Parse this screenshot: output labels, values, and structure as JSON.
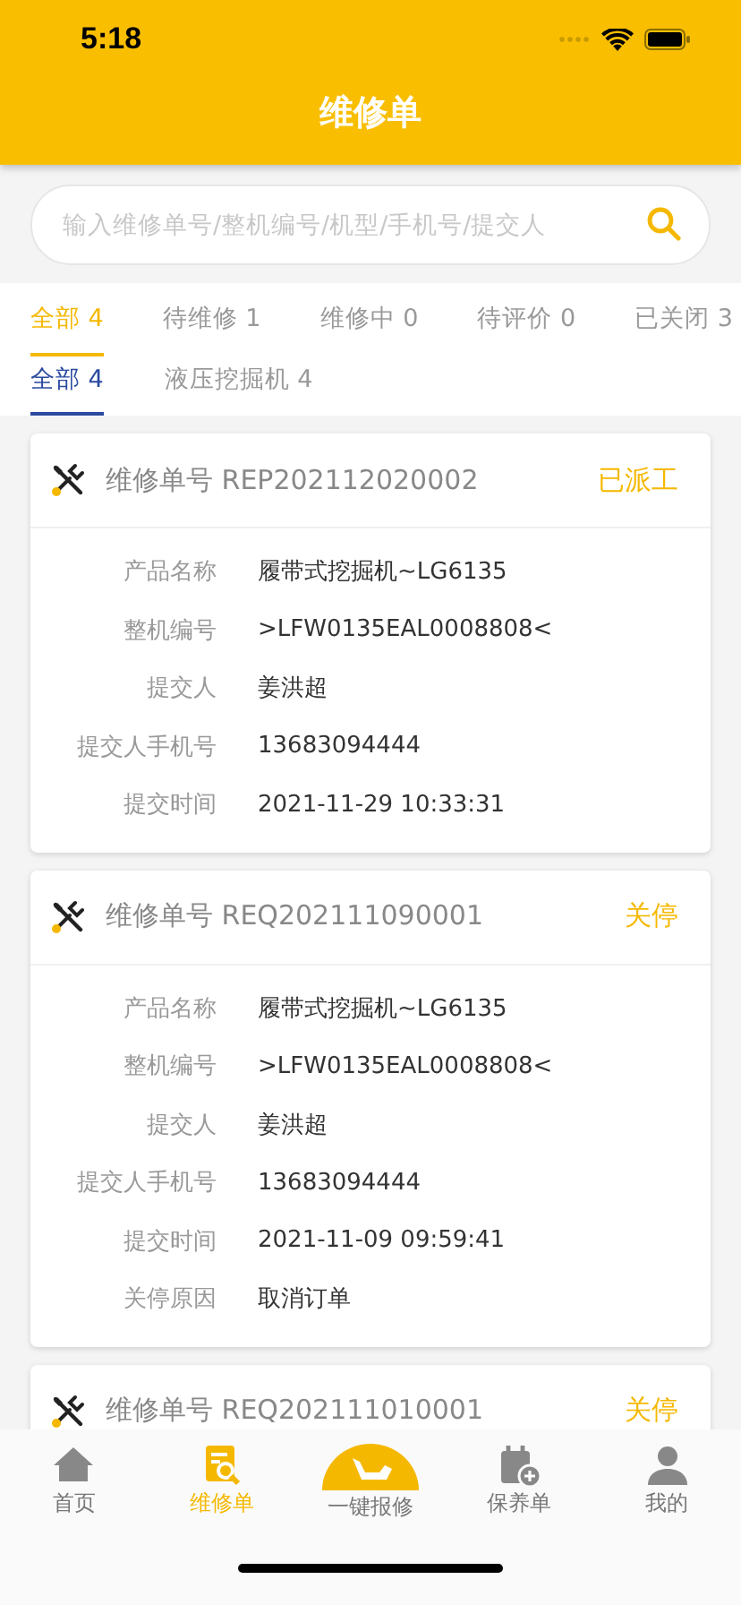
{
  "status_bar": {
    "time": "5:18"
  },
  "header": {
    "title": "维修单"
  },
  "search": {
    "placeholder": "输入维修单号/整机编号/机型/手机号/提交人"
  },
  "status_tabs": [
    {
      "label": "全部 4",
      "selected": true
    },
    {
      "label": "待维修 1",
      "selected": false
    },
    {
      "label": "维修中 0",
      "selected": false
    },
    {
      "label": "待评价 0",
      "selected": false
    },
    {
      "label": "已关闭 3",
      "selected": false
    }
  ],
  "type_tabs": [
    {
      "label": "全部 4",
      "selected": true
    },
    {
      "label": "液压挖掘机 4",
      "selected": false
    }
  ],
  "orders": [
    {
      "number": "维修单号 REP202112020002",
      "status": "已派工",
      "fields": [
        {
          "label": "产品名称",
          "value": "履带式挖掘机~LG6135"
        },
        {
          "label": "整机编号",
          "value": ">LFW0135EAL0008808<"
        },
        {
          "label": "提交人",
          "value": "姜洪超"
        },
        {
          "label": "提交人手机号",
          "value": "13683094444"
        },
        {
          "label": "提交时间",
          "value": "2021-11-29 10:33:31"
        }
      ]
    },
    {
      "number": "维修单号 REQ202111090001",
      "status": "关停",
      "fields": [
        {
          "label": "产品名称",
          "value": "履带式挖掘机~LG6135"
        },
        {
          "label": "整机编号",
          "value": ">LFW0135EAL0008808<"
        },
        {
          "label": "提交人",
          "value": "姜洪超"
        },
        {
          "label": "提交人手机号",
          "value": "13683094444"
        },
        {
          "label": "提交时间",
          "value": "2021-11-09 09:59:41"
        },
        {
          "label": "关停原因",
          "value": "取消订单"
        }
      ]
    },
    {
      "number": "维修单号 REQ202111010001",
      "status": "关停"
    }
  ],
  "tab_bar": [
    {
      "kind": "home",
      "label": "首页",
      "selected": false
    },
    {
      "kind": "repair",
      "label": "维修单",
      "selected": true
    },
    {
      "kind": "report",
      "label": "一键报修",
      "selected": false
    },
    {
      "kind": "maintain",
      "label": "保养单",
      "selected": false
    },
    {
      "kind": "me",
      "label": "我的",
      "selected": false
    }
  ]
}
